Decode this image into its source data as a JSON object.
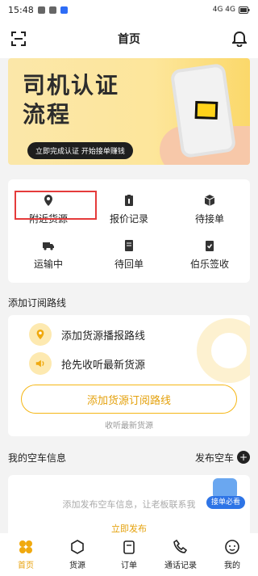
{
  "status": {
    "time": "15:48",
    "right_text": "4G 4G"
  },
  "header": {
    "title": "首页"
  },
  "banner": {
    "title_line1": "司机认证",
    "title_line2": "流程",
    "pill": "立即完成认证 开始接单赚钱"
  },
  "menu": [
    {
      "label": "附近货源",
      "icon": "location-pin-icon"
    },
    {
      "label": "报价记录",
      "icon": "clipboard-icon"
    },
    {
      "label": "待接单",
      "icon": "box-icon"
    },
    {
      "label": "运输中",
      "icon": "truck-icon"
    },
    {
      "label": "待回单",
      "icon": "document-icon"
    },
    {
      "label": "伯乐签收",
      "icon": "checklist-icon"
    }
  ],
  "subscribe": {
    "section_title": "添加订阅路线",
    "row1": "添加货源播报路线",
    "row2": "抢先收听最新货源",
    "button": "添加货源订阅路线",
    "note": "收听最新货源"
  },
  "empty_truck": {
    "section_title": "我的空车信息",
    "publish": "发布空车",
    "tip": "添加发布空车信息，让老板联系我",
    "link": "立即发布",
    "float_tag": "接单必看"
  },
  "tabs": [
    {
      "label": "首页",
      "icon": "home-icon",
      "active": true
    },
    {
      "label": "货源",
      "icon": "cube-icon",
      "active": false
    },
    {
      "label": "订单",
      "icon": "order-icon",
      "active": false
    },
    {
      "label": "通话记录",
      "icon": "phone-icon",
      "active": false
    },
    {
      "label": "我的",
      "icon": "face-icon",
      "active": false
    }
  ],
  "colors": {
    "accent": "#e8a20e",
    "highlight": "#e53b3b",
    "banner_bg": "#fde69b"
  }
}
